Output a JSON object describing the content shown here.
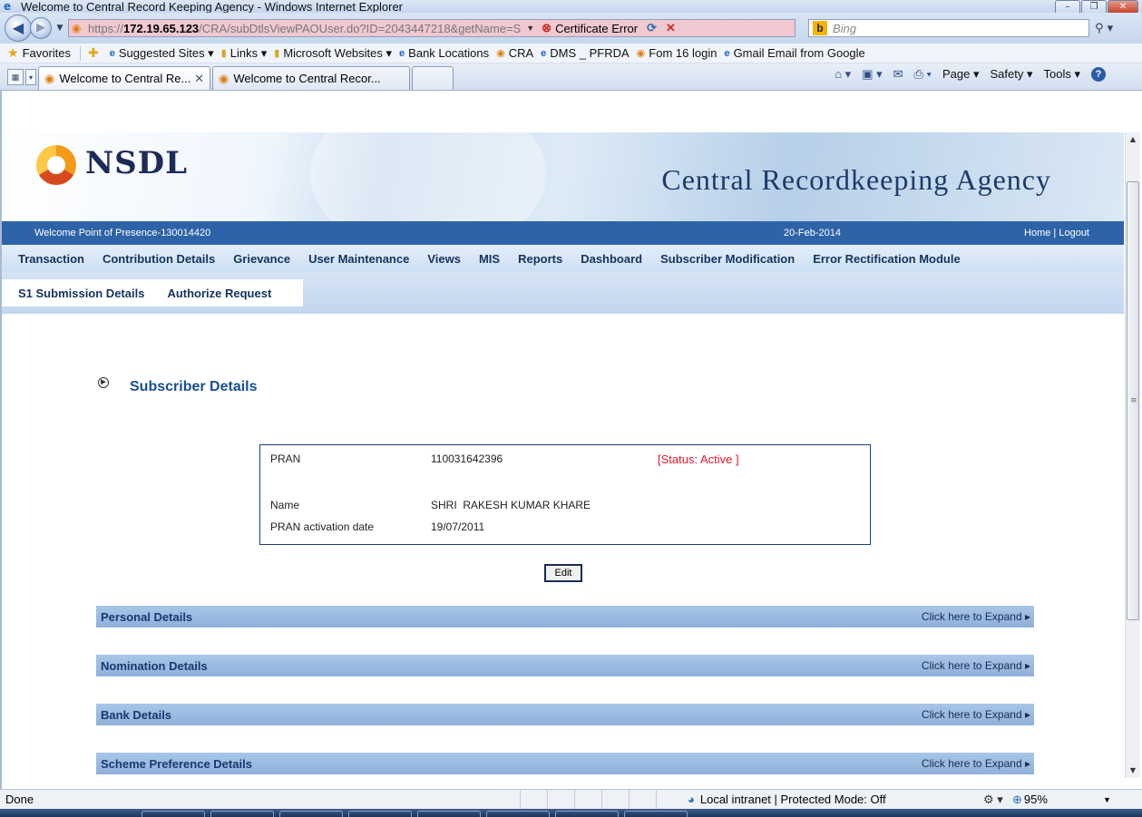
{
  "window": {
    "title": "Welcome to Central Record Keeping Agency - Windows Internet Explorer"
  },
  "address_bar": {
    "url_protocol": "https://",
    "url_host": "172.19.65.123",
    "url_path": "/CRA/subDtlsViewPAOUser.do?ID=2043447218&getName=S",
    "certificate_error": "Certificate Error",
    "search_placeholder": "Bing"
  },
  "favorites_bar": {
    "favorites_label": "Favorites",
    "items": [
      {
        "label": "Suggested Sites ▾",
        "icon": "ie-icon"
      },
      {
        "label": "Links ▾",
        "icon": "folder-icon"
      },
      {
        "label": "Microsoft Websites ▾",
        "icon": "folder-icon"
      },
      {
        "label": "Bank Locations",
        "icon": "ie-icon"
      },
      {
        "label": "CRA",
        "icon": "cra-icon"
      },
      {
        "label": "DMS _ PFRDA",
        "icon": "ie-icon"
      },
      {
        "label": "Fom 16 login",
        "icon": "cra-icon"
      },
      {
        "label": "Gmail Email from Google",
        "icon": "ie-icon"
      }
    ]
  },
  "tabs": [
    {
      "label": "Welcome to Central Re...",
      "active": true
    },
    {
      "label": "Welcome to Central Recor...",
      "active": false
    }
  ],
  "command_bar": {
    "page": "Page ▾",
    "safety": "Safety ▾",
    "tools": "Tools ▾"
  },
  "header": {
    "logo_text": "NSDL",
    "agency_title": "Central Recordkeeping Agency",
    "welcome": "Welcome Point of Presence-130014420",
    "date": "20-Feb-2014",
    "home": "Home",
    "separator": "|",
    "logout": "Logout"
  },
  "menu": {
    "items": [
      "Transaction",
      "Contribution Details",
      "Grievance",
      "User Maintenance",
      "Views",
      "MIS",
      "Reports",
      "Dashboard",
      "Subscriber Modification",
      "Error Rectification Module"
    ],
    "sub_items": [
      "S1 Submission Details",
      "Authorize Request"
    ]
  },
  "subscriber": {
    "heading": "Subscriber Details",
    "pran_label": "PRAN",
    "pran_value": "110031642396",
    "status": "[Status: Active ]",
    "name_label": "Name",
    "name_value": "SHRI  RAKESH KUMAR KHARE",
    "activation_label": "PRAN activation date",
    "activation_value": "19/07/2011",
    "edit_label": "Edit"
  },
  "sections": [
    {
      "title": "Personal Details",
      "action": "Click here to Expand ▸"
    },
    {
      "title": "Nomination Details",
      "action": "Click here to Expand ▸"
    },
    {
      "title": "Bank Details",
      "action": "Click here to Expand ▸"
    },
    {
      "title": "Scheme Preference Details",
      "action": "Click here to Expand ▸"
    }
  ],
  "status_bar": {
    "done": "Done",
    "zone": "Local intranet | Protected Mode: Off",
    "zoom": "95%"
  }
}
